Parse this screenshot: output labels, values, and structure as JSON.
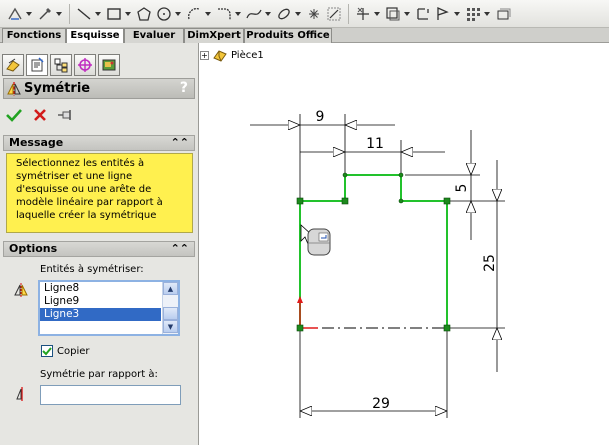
{
  "tabs": [
    {
      "label": "Fonctions",
      "active": false
    },
    {
      "label": "Esquisse",
      "active": true
    },
    {
      "label": "Evaluer",
      "active": false
    },
    {
      "label": "DimXpert",
      "active": false
    },
    {
      "label": "Produits Office",
      "active": false
    }
  ],
  "toolbar": {
    "icons": [
      "smart-dimension-icon",
      "line-icon",
      "rectangle-icon",
      "polygon-icon",
      "circle-icon",
      "arc-icon",
      "fillet-icon",
      "spline-icon",
      "point-icon",
      "convert-entities-icon",
      "trim-icon",
      "offset-icon",
      "mirror-icon",
      "linear-pattern-icon",
      "move-icon"
    ]
  },
  "property_manager": {
    "title": "Symétrie",
    "help": "?",
    "message": {
      "header": "Message",
      "text": "Sélectionnez les entités à symétriser et une ligne d'esquisse ou une arête de modèle linéaire par rapport à laquelle créer la symétrique"
    },
    "options": {
      "header": "Options",
      "entities_label": "Entités à symétriser:",
      "entities": [
        "Ligne8",
        "Ligne9",
        "Ligne3"
      ],
      "selected_entity": "Ligne3",
      "copy_label": "Copier",
      "copy_checked": true,
      "mirror_about_label": "Symétrie par rapport à:",
      "mirror_about_value": ""
    }
  },
  "feature_tree": {
    "part_name": "Pièce1"
  },
  "sketch": {
    "dimensions": {
      "d1": "9",
      "d2": "11",
      "d3": "5",
      "d4": "25",
      "d5": "29"
    }
  },
  "colors": {
    "sketch_line": "#22c22c",
    "sketch_point": "#1d8a1d",
    "message_bg": "#fff04f",
    "selection": "#316ac5"
  }
}
